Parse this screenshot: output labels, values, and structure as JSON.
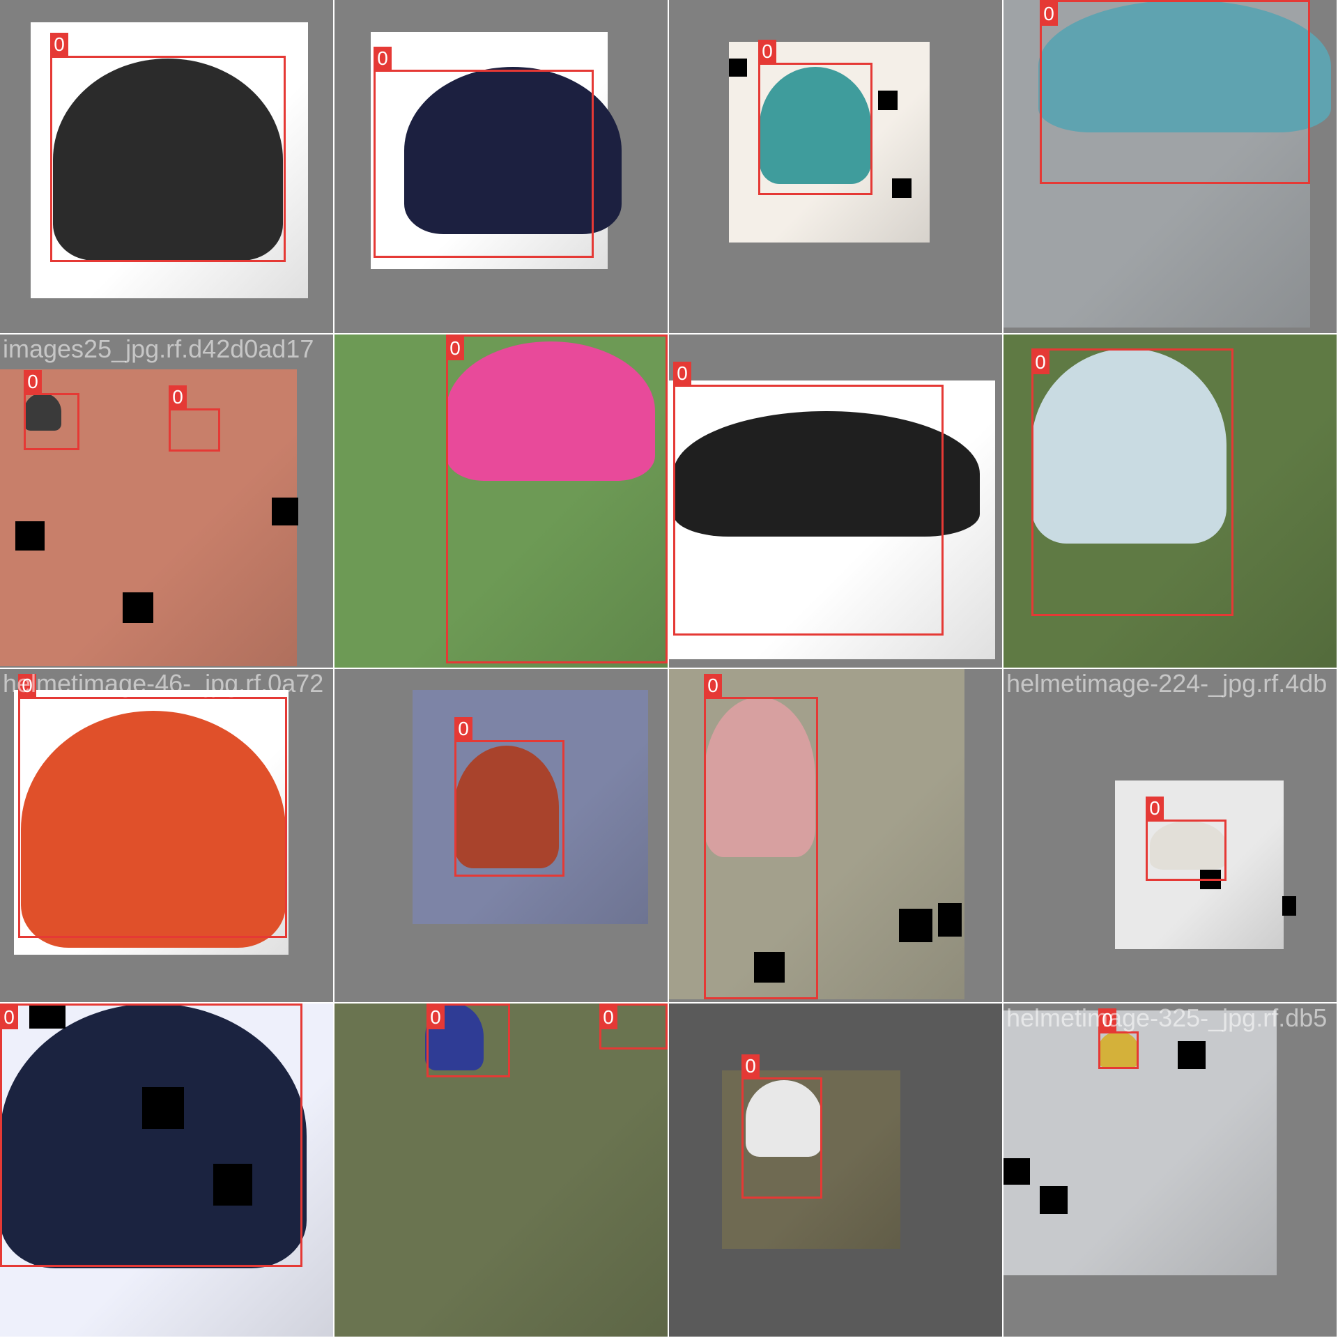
{
  "grid": {
    "tiles": [
      {
        "label": "0",
        "caption": "",
        "colors": {
          "bg": "#808080",
          "photo": "#ffffff",
          "obj": "#2b2b2b"
        }
      },
      {
        "label": "0",
        "caption": "",
        "colors": {
          "bg": "#808080",
          "photo": "#ffffff",
          "obj": "#1c2040"
        }
      },
      {
        "label": "0",
        "caption": "",
        "colors": {
          "bg": "#808080",
          "photo": "#f4efe8",
          "obj": "#3f9c9c"
        }
      },
      {
        "label": "0",
        "caption": "",
        "colors": {
          "bg": "#808080",
          "photo": "#9fa3a6",
          "obj": "#5fa3b0"
        }
      },
      {
        "label": "0",
        "caption": "images25_jpg.rf.d42d0ad17",
        "colors": {
          "bg": "#808080",
          "photo": "#c87f6a",
          "obj": "#3a3a3a"
        }
      },
      {
        "label": "0",
        "caption": "",
        "colors": {
          "bg": "#808080",
          "photo": "#6d9a55",
          "obj": "#e84a9a"
        }
      },
      {
        "label": "0",
        "caption": "",
        "colors": {
          "bg": "#808080",
          "photo": "#ffffff",
          "obj": "#1f1f1f"
        }
      },
      {
        "label": "0",
        "caption": "",
        "colors": {
          "bg": "#808080",
          "photo": "#5f7a44",
          "obj": "#c9dbe2"
        }
      },
      {
        "label": "0",
        "caption": "helmetimage-46-_jpg.rf.0a72",
        "colors": {
          "bg": "#808080",
          "photo": "#ffffff",
          "obj": "#e0502a"
        }
      },
      {
        "label": "0",
        "caption": "",
        "colors": {
          "bg": "#808080",
          "photo": "#7d84a6",
          "obj": "#a9432c"
        }
      },
      {
        "label": "0",
        "caption": "",
        "colors": {
          "bg": "#808080",
          "photo": "#a3a08c",
          "obj": "#d7a0a0"
        }
      },
      {
        "label": "0",
        "caption": "helmetimage-224-_jpg.rf.4db",
        "colors": {
          "bg": "#808080",
          "photo": "#e9e9e9",
          "obj": "#e2dfd8"
        }
      },
      {
        "label": "0",
        "caption": "",
        "colors": {
          "bg": "#808080",
          "photo": "#eef0fb",
          "obj": "#1b2340"
        }
      },
      {
        "label": "0",
        "caption": "",
        "colors": {
          "bg": "#808080",
          "photo": "#6a7450",
          "obj": "#2f3c95"
        }
      },
      {
        "label": "0",
        "caption": "",
        "colors": {
          "bg": "#5a5a5a",
          "photo": "#6f6a52",
          "obj": "#e8e8e8"
        }
      },
      {
        "label": "0",
        "caption": "helmetimage-325-_jpg.rf.db5",
        "colors": {
          "bg": "#808080",
          "photo": "#c7c9cc",
          "obj": "#d4b13a"
        }
      }
    ]
  }
}
